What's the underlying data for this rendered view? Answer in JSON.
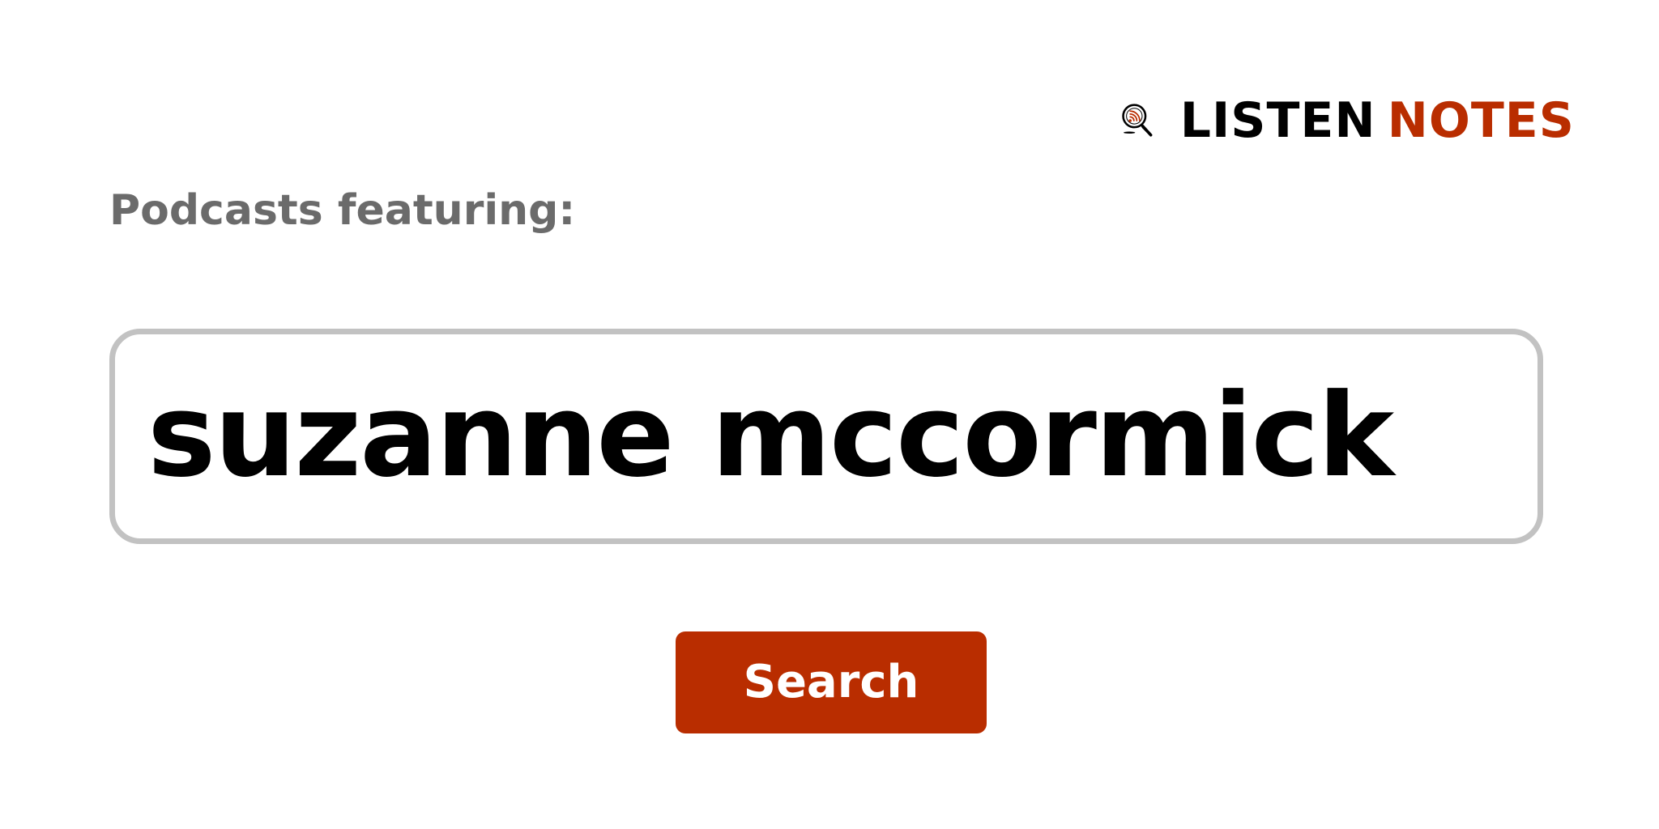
{
  "logo": {
    "word1": "LISTEN",
    "word2": "NOTES",
    "icon": "podcast-search-icon",
    "color_dark": "#000000",
    "color_accent": "#b92d00"
  },
  "label": "Podcasts featuring:",
  "search": {
    "query": "suzanne mccormick"
  },
  "button": {
    "label": "Search",
    "color": "#b92d00"
  }
}
